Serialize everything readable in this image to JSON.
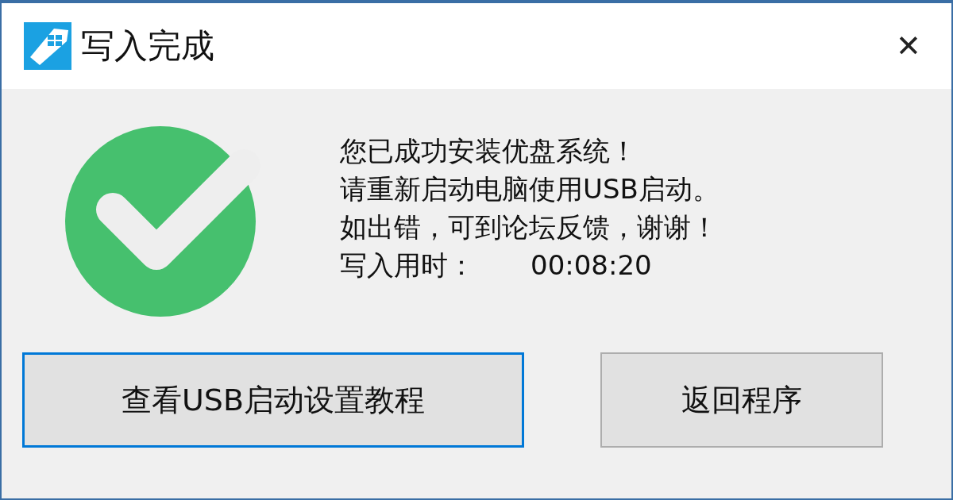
{
  "window": {
    "title": "写入完成",
    "close": "✕"
  },
  "message": {
    "lines": [
      "您已成功安装优盘系统！",
      "请重新启动电脑使用USB启动。",
      "如出错，可到论坛反馈，谢谢！"
    ],
    "time_label": "写入用时：",
    "time_value": "00:08:20"
  },
  "buttons": [
    {
      "label": "查看USB启动设置教程",
      "focused": true
    },
    {
      "label": "返回程序",
      "focused": false
    }
  ]
}
